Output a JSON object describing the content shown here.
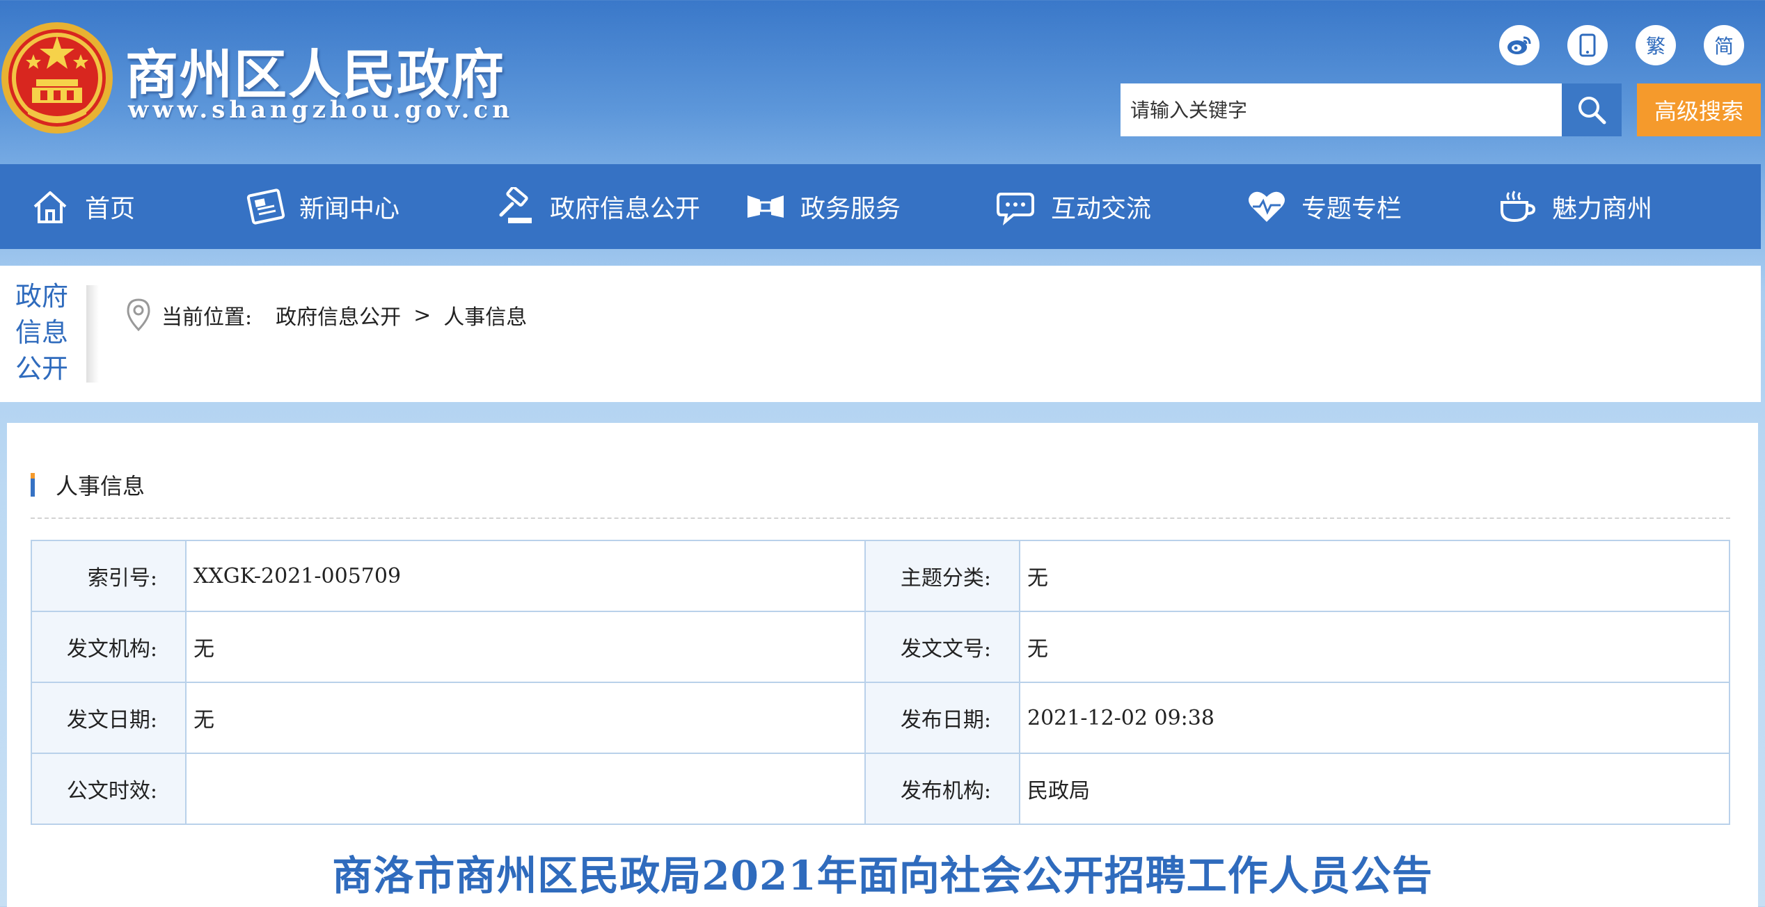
{
  "header": {
    "site_title": "商州区人民政府",
    "site_url": "www.shangzhou.gov.cn",
    "top_icons": [
      {
        "name": "weibo-icon",
        "label": ""
      },
      {
        "name": "mobile-icon",
        "label": ""
      },
      {
        "name": "traditional-chinese-button",
        "label": "繁"
      },
      {
        "name": "simplified-chinese-button",
        "label": "简"
      }
    ],
    "search": {
      "placeholder": "请输入关键字",
      "advanced_label": "高级搜索"
    }
  },
  "nav": {
    "items": [
      {
        "label": "首页",
        "icon": "home-icon"
      },
      {
        "label": "新闻中心",
        "icon": "newspaper-icon"
      },
      {
        "label": "政府信息公开",
        "icon": "gavel-icon"
      },
      {
        "label": "政务服务",
        "icon": "handshake-icon"
      },
      {
        "label": "互动交流",
        "icon": "chat-icon"
      },
      {
        "label": "专题专栏",
        "icon": "heart-icon"
      },
      {
        "label": "魅力商州",
        "icon": "cup-icon"
      }
    ]
  },
  "breadcrumb": {
    "side_label": [
      "政府",
      "信息",
      "公开"
    ],
    "current_label": "当前位置:",
    "path": [
      "政府信息公开",
      "人事信息"
    ],
    "separator": ">"
  },
  "section": {
    "title": "人事信息"
  },
  "meta": {
    "rows": [
      {
        "k1": "索引号:",
        "v1": "XXGK-2021-005709",
        "k2": "主题分类:",
        "v2": "无"
      },
      {
        "k1": "发文机构:",
        "v1": "无",
        "k2": "发文文号:",
        "v2": "无"
      },
      {
        "k1": "发文日期:",
        "v1": "无",
        "k2": "发布日期:",
        "v2": "2021-12-02 09:38"
      },
      {
        "k1": "公文时效:",
        "v1": "",
        "k2": "发布机构:",
        "v2": "民政局"
      }
    ]
  },
  "article": {
    "title": "商洛市商州区民政局2021年面向社会公开招聘工作人员公告"
  },
  "colors": {
    "nav_blue": "#3672c4",
    "accent_orange": "#f59a2c",
    "title_blue": "#2f6bbd"
  }
}
